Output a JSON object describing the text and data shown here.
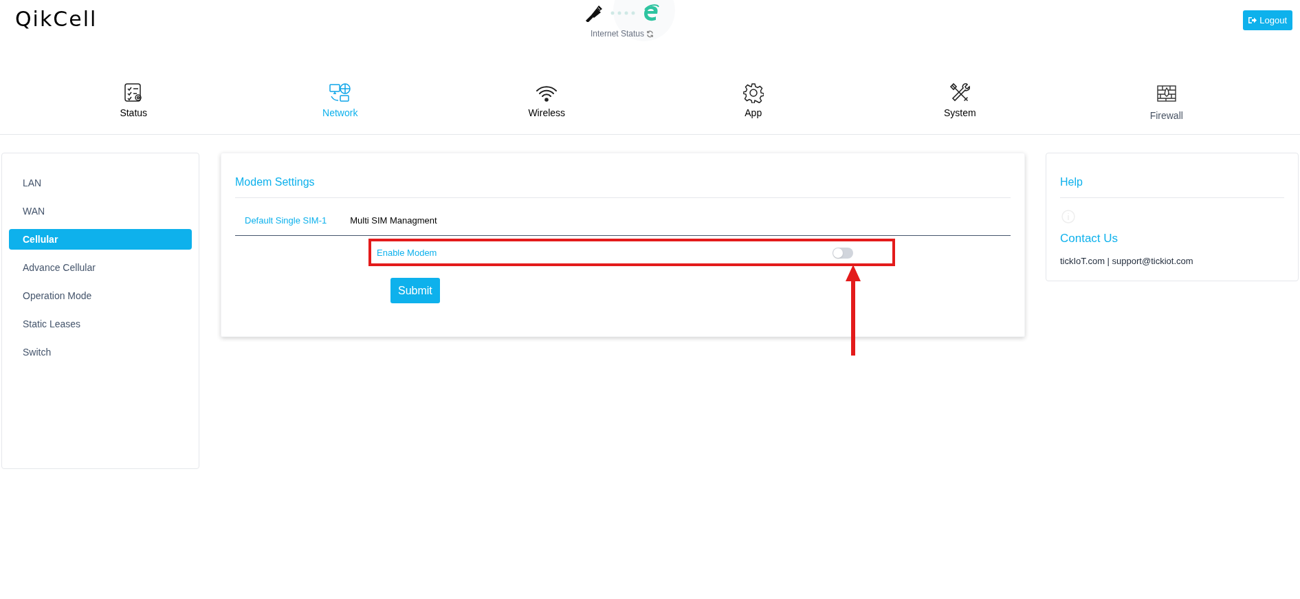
{
  "header": {
    "logo": "QikCell",
    "internet_status": {
      "label": "Internet Status",
      "connected": true
    },
    "logout": "Logout"
  },
  "nav": [
    {
      "label": "Status",
      "kind": "status",
      "selected": false
    },
    {
      "label": "Network",
      "kind": "network",
      "selected": true
    },
    {
      "label": "Wireless",
      "kind": "wireless",
      "selected": false
    },
    {
      "label": "App",
      "kind": "app",
      "selected": false
    },
    {
      "label": "System",
      "kind": "system",
      "selected": false
    },
    {
      "label": "Firewall",
      "kind": "firewall",
      "selected": false
    }
  ],
  "sidebar": {
    "items": [
      {
        "label": "LAN",
        "selected": false
      },
      {
        "label": "WAN",
        "selected": false
      },
      {
        "label": "Cellular",
        "selected": true
      },
      {
        "label": "Advance Cellular",
        "selected": false
      },
      {
        "label": "Operation Mode",
        "selected": false
      },
      {
        "label": "Static Leases",
        "selected": false
      },
      {
        "label": "Switch",
        "selected": false
      }
    ]
  },
  "modem_settings": {
    "title": "Modem Settings",
    "tabs": [
      {
        "label": "Default Single SIM-1",
        "selected": true
      },
      {
        "label": "Multi SIM Managment",
        "selected": false
      }
    ],
    "enable_modem": {
      "label": "Enable Modem",
      "on": false
    },
    "submit": "Submit"
  },
  "help": {
    "title": "Help",
    "contact_title": "Contact Us",
    "contact_text": "tickIoT.com | support@tickiot.com"
  }
}
